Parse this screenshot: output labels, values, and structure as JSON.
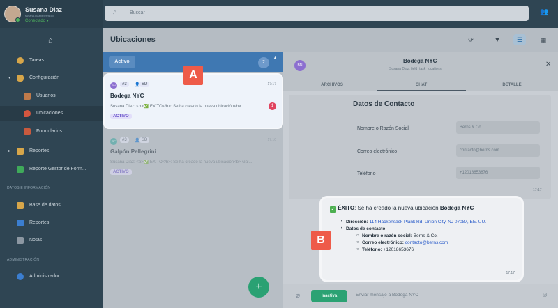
{
  "user": {
    "name": "Susana Diaz",
    "email": "susana.diaz@berns.co",
    "status": "Conectado"
  },
  "sidebar": {
    "items": [
      {
        "label": "Tareas"
      },
      {
        "label": "Configuración"
      },
      {
        "label": "Usuarios"
      },
      {
        "label": "Ubicaciones"
      },
      {
        "label": "Formularios"
      },
      {
        "label": "Reportes"
      },
      {
        "label": "Reporte Gestor de Form..."
      },
      {
        "label": "Base de datos"
      },
      {
        "label": "Reportes"
      },
      {
        "label": "Notas"
      },
      {
        "label": "Administrador"
      }
    ],
    "sections": [
      "DATOS E INFORMACIÓN",
      "ADMINISTRACIÓN"
    ]
  },
  "search": {
    "placeholder": "Buscar"
  },
  "page": {
    "title": "Ubicaciones"
  },
  "list": {
    "tab_label": "Activo",
    "count_badge": "2",
    "cards": [
      {
        "initials": "BN",
        "number": "#3",
        "assignee": "SD",
        "time": "17:17",
        "name": "Bodega NYC",
        "message": "Susana Diaz: <b>✅ ÉXITO</b>: Se ha creado la nueva ubicación<b> ...",
        "unread": "1",
        "status": "ACTIVO"
      },
      {
        "initials": "GP",
        "number": "#3",
        "assignee": "SD",
        "time": "17:10",
        "name": "Galpón Pellegrini",
        "message": "Susana Diaz: <b>✅ ÉXITO</b>: Se ha creado la nueva ubicación<b> Gal...",
        "status": "ACTIVO"
      }
    ]
  },
  "chat": {
    "avatar_initials": "BN",
    "title": "Bodega NYC",
    "subtitle": "Susana Diaz, field_task_locations",
    "tabs": [
      "ARCHIVOS",
      "CHAT",
      "DETALLE"
    ],
    "contact": {
      "title": "Datos de Contacto",
      "rows": [
        {
          "label": "Nombre o Razón Social",
          "value": "Berns & Co."
        },
        {
          "label": "Correo electrónico",
          "value": "contacto@berns.com"
        },
        {
          "label": "Teléfono",
          "value": "+12018653676"
        }
      ],
      "time": "17:17"
    },
    "message": {
      "check": "✓",
      "head_bold": "ÉXITO",
      "head_text": ": Se ha creado la nueva ubicación ",
      "head_location": "Bodega NYC",
      "address_label": "Dirección:",
      "address_value": "114 Hackensack Plank Rd, Union City, NJ 07087, EE. UU.",
      "contact_label": "Datos de contacto:",
      "name_label": "Nombre o razón social:",
      "name_value": "Berns & Co.",
      "email_label": "Correo electrónico:",
      "email_value": "contacto@berns.com",
      "phone_label": "Teléfono:",
      "phone_value": "+12018653676",
      "time": "17:17"
    },
    "composer": {
      "status_button": "Inactiva",
      "placeholder": "Enviar mensaje a Bodega NYC"
    }
  },
  "annotations": [
    "A",
    "B"
  ],
  "colors": {
    "sidebar": "#2f4553",
    "accent_blue": "#3f78b2",
    "success_green": "#2aa173",
    "badge_red": "#ee5b49",
    "unread": "#e0435e"
  }
}
